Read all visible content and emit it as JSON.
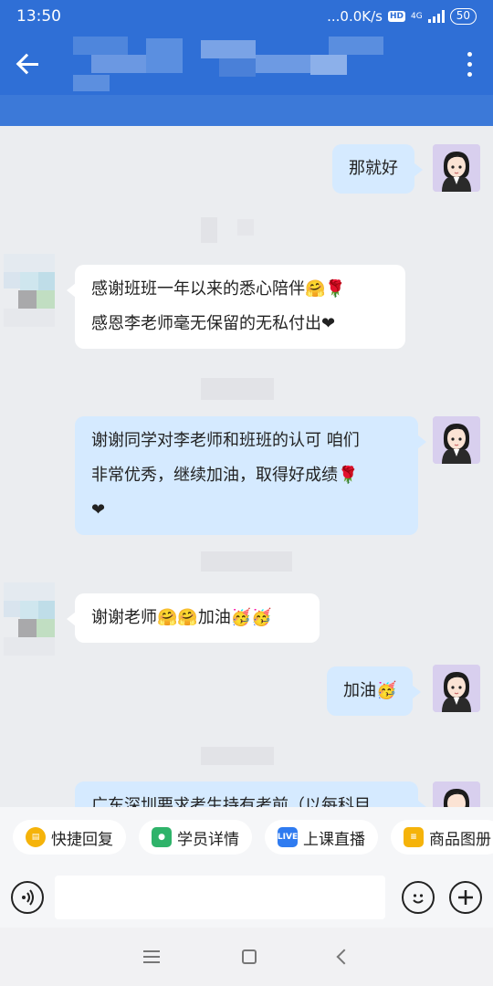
{
  "status": {
    "time": "13:50",
    "network_speed": "...0.0K/s",
    "hd": "HD",
    "network": "4G",
    "battery": "50"
  },
  "header": {
    "back_icon": "arrow-left",
    "more_icon": "vertical-dots"
  },
  "messages": [
    {
      "side": "mine",
      "text": "那就好"
    },
    {
      "side": "theirs",
      "lines": [
        "感谢班班一年以来的悉心陪伴🤗🌹",
        "感恩李老师毫无保留的无私付出❤"
      ]
    },
    {
      "side": "mine",
      "lines": [
        "谢谢同学对李老师和班班的认可  咱们",
        "非常优秀，继续加油，取得好成绩🌹",
        "❤"
      ]
    },
    {
      "side": "theirs",
      "text": "谢谢老师🤗🤗加油🥳🥳"
    },
    {
      "side": "mine",
      "text": "加油🥳"
    },
    {
      "side": "mine",
      "text": "广东深圳要求考生持有考前（以每科目"
    }
  ],
  "quick_actions": [
    {
      "label": "快捷回复",
      "icon": "quick-reply-icon",
      "color": "#f5b30a"
    },
    {
      "label": "学员详情",
      "icon": "student-icon",
      "color": "#2fb36a"
    },
    {
      "label": "上课直播",
      "icon": "live-icon",
      "color": "#2f7bf0",
      "icon_text": "LIVE"
    },
    {
      "label": "商品图册",
      "icon": "catalog-icon",
      "color": "#f5b30a"
    }
  ],
  "input": {
    "placeholder": ""
  }
}
